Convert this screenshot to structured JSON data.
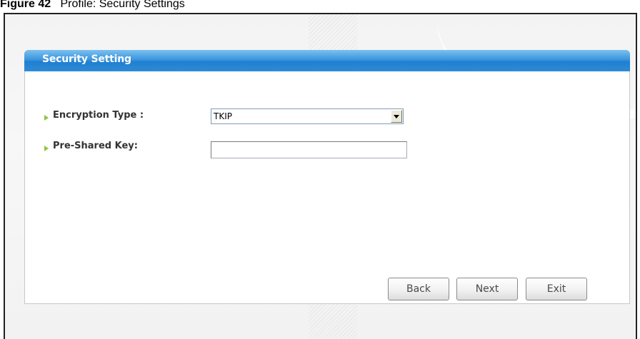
{
  "caption": {
    "prefix": "Figure 42",
    "title": "Profile: Security Settings"
  },
  "panel": {
    "title": "Security Setting"
  },
  "fields": {
    "encryption_label": "Encryption Type :",
    "encryption_value": "TKIP",
    "psk_label": "Pre-Shared Key:",
    "psk_value": ""
  },
  "buttons": {
    "back": "Back",
    "next": "Next",
    "exit": "Exit"
  },
  "colors": {
    "header_blue": "#2f8ad5",
    "bullet_green": "#8cc63f"
  },
  "icons": {
    "bullet": "arrow-icon",
    "dropdown": "chevron-down-icon"
  }
}
